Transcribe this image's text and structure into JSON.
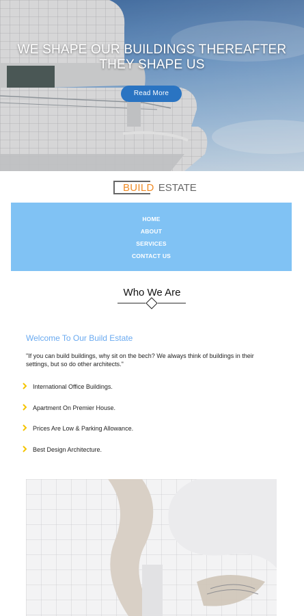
{
  "hero": {
    "title_line1": "WE SHAPE OUR BUILDINGS THEREAFTER",
    "title_line2": "THEY SHAPE US",
    "button_label": "Read More"
  },
  "logo": {
    "part1": "BUILD",
    "part2": "ESTATE"
  },
  "nav": {
    "items": [
      "HOME",
      "ABOUT",
      "SERVICES",
      "CONTACT US"
    ]
  },
  "section": {
    "title": "Who We Are"
  },
  "about": {
    "welcome": "Welcome To Our Build Estate",
    "quote": "\"If you can build buildings, why sit on the bech? We always think of buildings in their settings, but so do other architects.\"",
    "features": [
      "International Office Buildings.",
      "Apartment On Premier House.",
      "Prices Are Low & Parking Allowance.",
      "Best Design Architecture."
    ]
  },
  "colors": {
    "accent_blue": "#2a74c2",
    "nav_bg": "#80c2f4",
    "logo_orange": "#f08a24",
    "welcome_blue": "#6aaaf0",
    "chevron_yellow": "#f5c400"
  }
}
